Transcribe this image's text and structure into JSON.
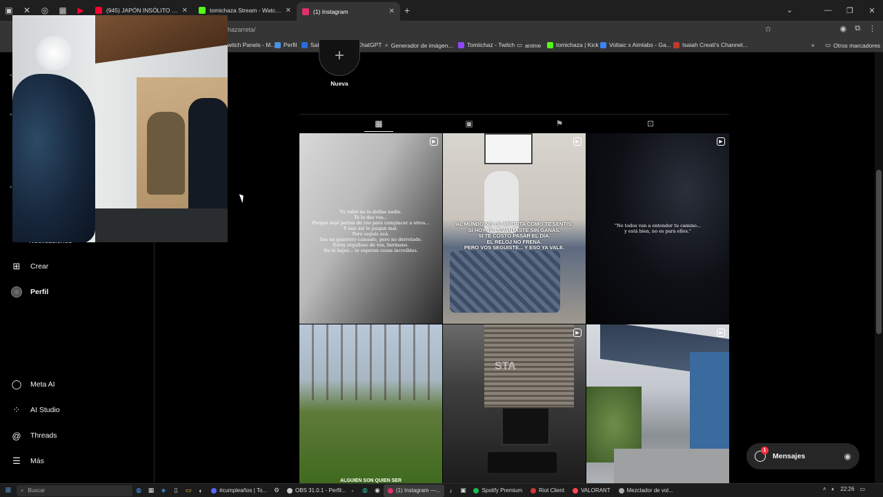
{
  "browser": {
    "tabs": [
      {
        "title": "(945) JAPÓN INSÓLITO | Las ma",
        "color": "#ff0033",
        "active": false
      },
      {
        "title": "tomichaza Stream - Watch Live",
        "color": "#53fc18",
        "active": false
      },
      {
        "title": "(1) Instagram",
        "color": "#e1306c",
        "active": true
      }
    ],
    "url": "hazarreta/",
    "bookmarks": [
      {
        "label": "witch Panels - M...",
        "color": "#9146ff"
      },
      {
        "label": "Perfil",
        "color": "#4a90e2"
      },
      {
        "label": "Satoshitango",
        "color": "#2a6bd8"
      },
      {
        "label": "ChatGPT",
        "color": "#dddddd"
      },
      {
        "label": "Generador de imágen...",
        "color": "#888888"
      },
      {
        "label": "Tomiichaz - Twitch",
        "color": "#9146ff"
      },
      {
        "label": "anime",
        "color": "#aaaaaa"
      },
      {
        "label": "tomichaza | Kick",
        "color": "#53fc18"
      },
      {
        "label": "Voltaic x Aimlabs - Ga...",
        "color": "#3b82f6"
      },
      {
        "label": "Isaiah Creati's Channel...",
        "color": "#c0392b"
      }
    ],
    "other_bookmarks": "Otros marcadores"
  },
  "sidebar": {
    "partial_label": "Notificaciones",
    "items": [
      {
        "label": "Crear",
        "icon": "plus-square-icon"
      },
      {
        "label": "Perfil",
        "icon": "avatar"
      },
      {
        "label": "Meta AI",
        "icon": "meta-ai-icon"
      },
      {
        "label": "AI Studio",
        "icon": "ai-studio-icon"
      },
      {
        "label": "Threads",
        "icon": "threads-icon"
      },
      {
        "label": "Más",
        "icon": "menu-icon"
      }
    ]
  },
  "profile": {
    "new_story_label": "Nueva",
    "tabs": [
      "posts",
      "reels",
      "saved",
      "tagged"
    ]
  },
  "posts": [
    {
      "caption": "Tu valor no lo define nadie.\nTe lo das vos...\nPorque dejé partes de vos para complacer a otros...\nY aun así te juzgan mal.\nPero seguís acá.\nSos un guerrero cansado, pero no derrotado.\nEstoy orgulloso de vos, hermano.\nNo le bajes... te esperan cosas increíbles.",
      "style": "serif"
    },
    {
      "caption": "AL MUNDO NO LE IMPORTA CÓMO TE SENTÍS.\nSI HOY TE LEVANTASTE SIN GANAS.\nSI TE COSTÓ PASAR EL DÍA.\nEL RELOJ NO FRENA.\nPERO VOS SEGUISTE... Y ESO YA VALE.",
      "style": "bold"
    },
    {
      "caption": "\"No todos van a entender tu camino...\ny está bien, no es para ellos.\"",
      "style": "serif"
    },
    {
      "caption": "ALGUIEN SON QUIEN SER",
      "style": "bold"
    },
    {
      "caption": "STA",
      "style": "overlay"
    },
    {
      "caption": "",
      "style": "none"
    }
  ],
  "messages": {
    "label": "Mensajes",
    "badge": "1"
  },
  "taskbar": {
    "search_placeholder": "Buscar",
    "apps": [
      {
        "label": "#cumpleaños | To...",
        "color": "#5865f2"
      },
      {
        "label": "OBS 31.0.1 - Perfil:...",
        "color": "#cccccc"
      },
      {
        "label": "(1) Instagram —...",
        "color": "#e1306c"
      },
      {
        "label": "Spotify Premium",
        "color": "#1db954"
      },
      {
        "label": "Riot Client",
        "color": "#d13639"
      },
      {
        "label": "VALORANT",
        "color": "#ff4655"
      },
      {
        "label": "Mezclador de vol...",
        "color": "#aaaaaa"
      }
    ],
    "time": "22:26"
  }
}
